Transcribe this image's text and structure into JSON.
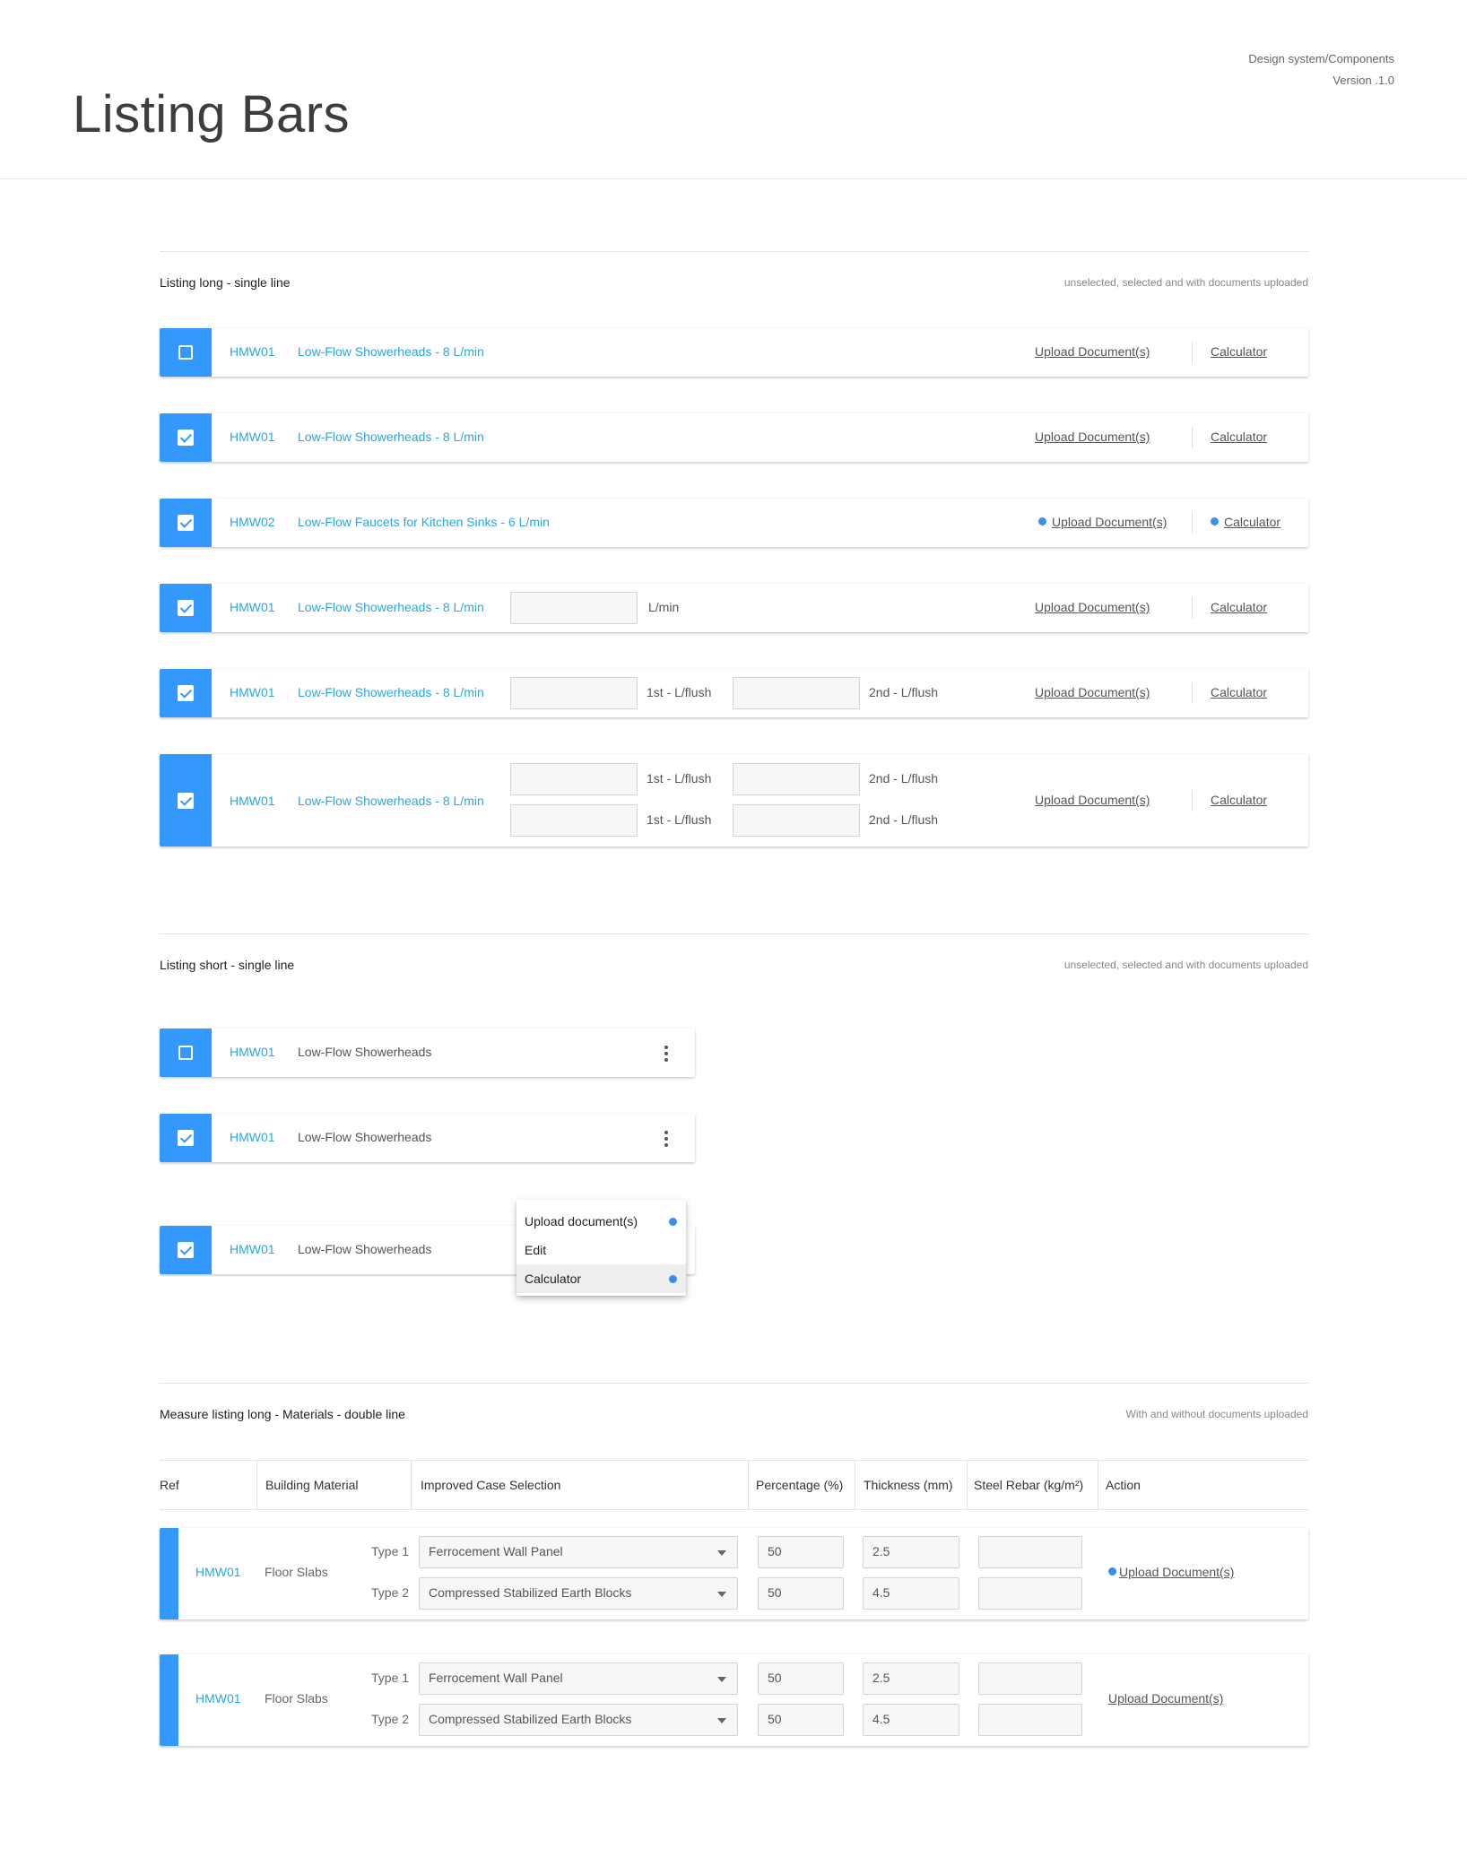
{
  "header": {
    "title": "Listing Bars",
    "design_system": "Design system/Components",
    "version": "Version .1.0"
  },
  "accent_color": "#3399ff",
  "link_color": "#2aa7e0",
  "sections": {
    "long": {
      "title": "Listing long - single line",
      "note": "unselected, selected and with documents uploaded"
    },
    "short": {
      "title": "Listing short - single line",
      "note": "unselected, selected and with documents uploaded"
    },
    "measure": {
      "title": "Measure listing long - Materials - double line",
      "note": "With and without documents uploaded"
    }
  },
  "long_rows": [
    {
      "code": "HMW01",
      "name": "Low-Flow Showerheads - 8 L/min",
      "checked": false,
      "upload": "Upload Document(s)",
      "calc": "Calculator"
    },
    {
      "code": "HMW01",
      "name": "Low-Flow Showerheads - 8 L/min",
      "checked": true,
      "upload": "Upload Document(s)",
      "calc": "Calculator"
    },
    {
      "code": "HMW02",
      "name": "Low-Flow Faucets for Kitchen Sinks - 6 L/min",
      "checked": true,
      "upload": "Upload Document(s)",
      "calc": "Calculator",
      "uploaded": true
    },
    {
      "code": "HMW01",
      "name": "Low-Flow Showerheads - 8 L/min",
      "checked": true,
      "unit1": "L/min",
      "upload": "Upload Document(s)",
      "calc": "Calculator"
    },
    {
      "code": "HMW01",
      "name": "Low-Flow Showerheads - 8 L/min",
      "checked": true,
      "unit1": "1st - L/flush",
      "unit2": "2nd - L/flush",
      "upload": "Upload Document(s)",
      "calc": "Calculator"
    },
    {
      "code": "HMW01",
      "name": "Low-Flow Showerheads - 8 L/min",
      "checked": true,
      "unit1": "1st - L/flush",
      "unit2": "2nd - L/flush",
      "unit3": "1st - L/flush",
      "unit4": "2nd - L/flush",
      "upload": "Upload Document(s)",
      "calc": "Calculator"
    }
  ],
  "short_rows": [
    {
      "code": "HMW01",
      "name": "Low-Flow Showerheads",
      "checked": false
    },
    {
      "code": "HMW01",
      "name": "Low-Flow Showerheads",
      "checked": true
    },
    {
      "code": "HMW01",
      "name": "Low-Flow Showerheads",
      "checked": true
    }
  ],
  "menu": {
    "items": [
      "Upload document(s)",
      "Edit",
      "Calculator"
    ],
    "highlighted": "Calculator"
  },
  "table": {
    "headers": [
      "Ref",
      "Building Material",
      "Improved Case Selection",
      "Percentage (%)",
      "Thickness (mm)",
      "Steel Rebar (kg/m²)",
      "Action"
    ]
  },
  "measure_rows": [
    {
      "ref": "HMW01",
      "material": "Floor Slabs",
      "type1": "Type 1",
      "type2": "Type 2",
      "sel1": "Ferrocement Wall Panel",
      "sel2": "Compressed Stabilized Earth Blocks",
      "pct1": "50",
      "pct2": "50",
      "thk1": "2.5",
      "thk2": "4.5",
      "action": "Upload Document(s)",
      "uploaded": true
    },
    {
      "ref": "HMW01",
      "material": "Floor Slabs",
      "type1": "Type 1",
      "type2": "Type 2",
      "sel1": "Ferrocement Wall Panel",
      "sel2": "Compressed Stabilized Earth Blocks",
      "pct1": "50",
      "pct2": "50",
      "thk1": "2.5",
      "thk2": "4.5",
      "action": "Upload Document(s)",
      "uploaded": false
    }
  ]
}
